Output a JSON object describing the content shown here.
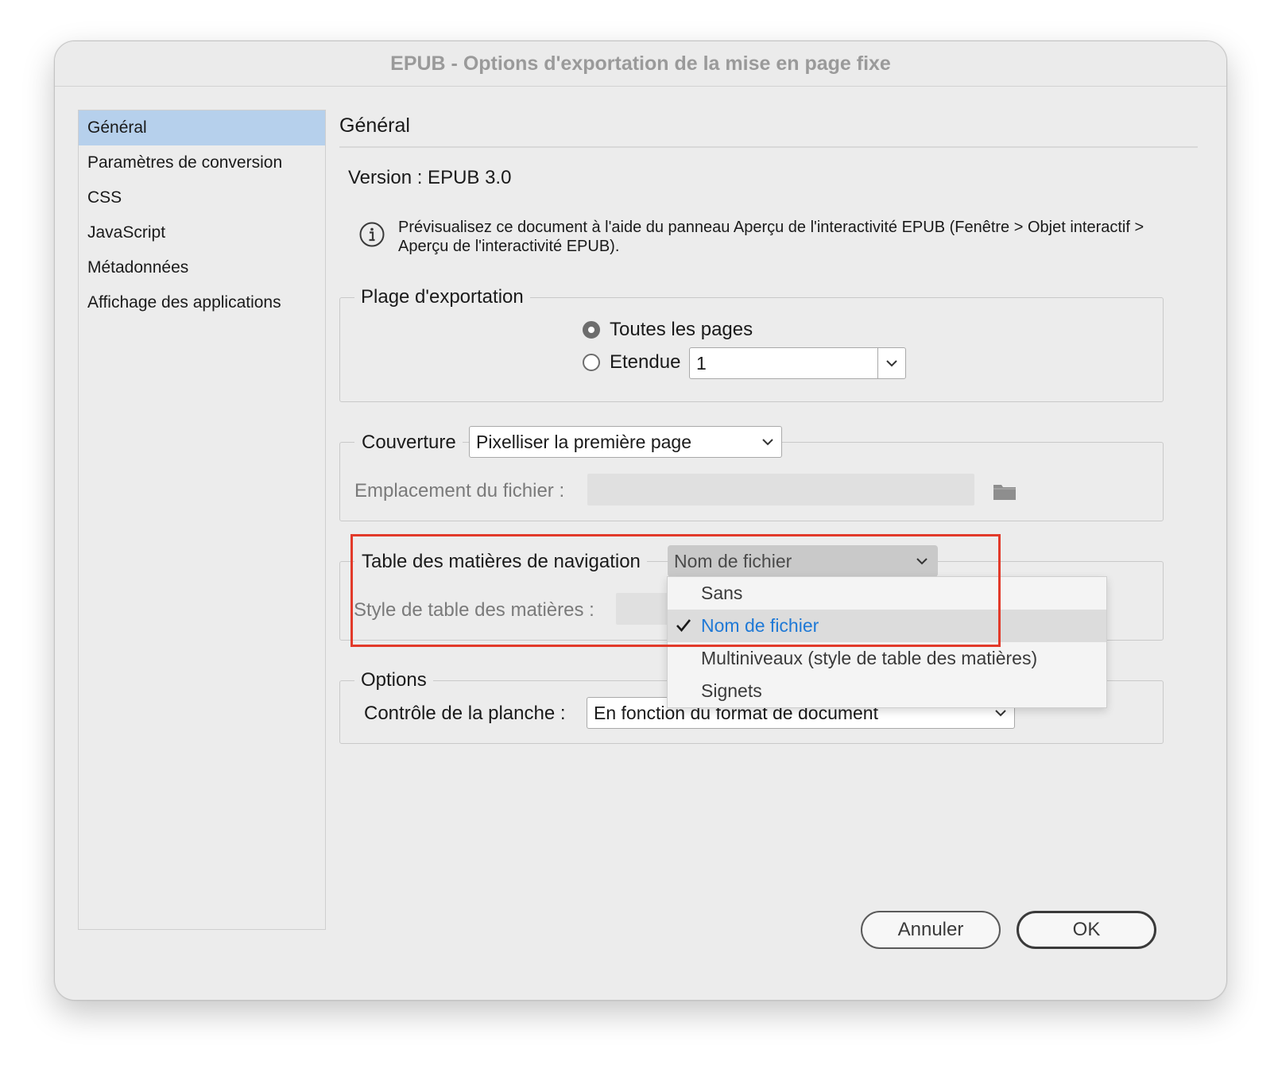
{
  "window": {
    "title": "EPUB - Options d'exportation de la mise en page fixe"
  },
  "sidebar": {
    "items": [
      {
        "label": "Général",
        "selected": true
      },
      {
        "label": "Paramètres de conversion",
        "selected": false
      },
      {
        "label": "CSS",
        "selected": false
      },
      {
        "label": "JavaScript",
        "selected": false
      },
      {
        "label": "Métadonnées",
        "selected": false
      },
      {
        "label": "Affichage des applications",
        "selected": false
      }
    ]
  },
  "panel": {
    "title": "Général",
    "version": "Version : EPUB 3.0",
    "info_text": "Prévisualisez ce document à l'aide du panneau Aperçu de l'interactivité EPUB (Fenêtre > Objet interactif > Aperçu de l'interactivité EPUB).",
    "info_icon": "info-icon"
  },
  "export_range": {
    "legend": "Plage d'exportation",
    "all_pages_label": "Toutes les pages",
    "range_label": "Etendue",
    "range_value": "1",
    "selected": "all_pages"
  },
  "cover": {
    "label": "Couverture",
    "value": "Pixelliser la première page",
    "file_location_label": "Emplacement du fichier :",
    "folder_icon": "folder-icon"
  },
  "navigation_toc": {
    "label": "Table des matières de navigation",
    "value": "Nom de fichier",
    "toc_style_label": "Style de table des matières :",
    "dropdown_options": [
      {
        "label": "Sans",
        "selected": false
      },
      {
        "label": "Nom de fichier",
        "selected": true
      },
      {
        "label": "Multiniveaux (style de table des matières)",
        "selected": false
      },
      {
        "label": "Signets",
        "selected": false
      }
    ]
  },
  "options": {
    "legend": "Options",
    "spread_control_label": "Contrôle de la planche :",
    "spread_control_value": "En fonction du format de document"
  },
  "buttons": {
    "cancel": "Annuler",
    "ok": "OK"
  },
  "colors": {
    "selection": "#b6d0ec",
    "highlight_box": "#e23a2a",
    "selected_option_text": "#1f79d6"
  }
}
